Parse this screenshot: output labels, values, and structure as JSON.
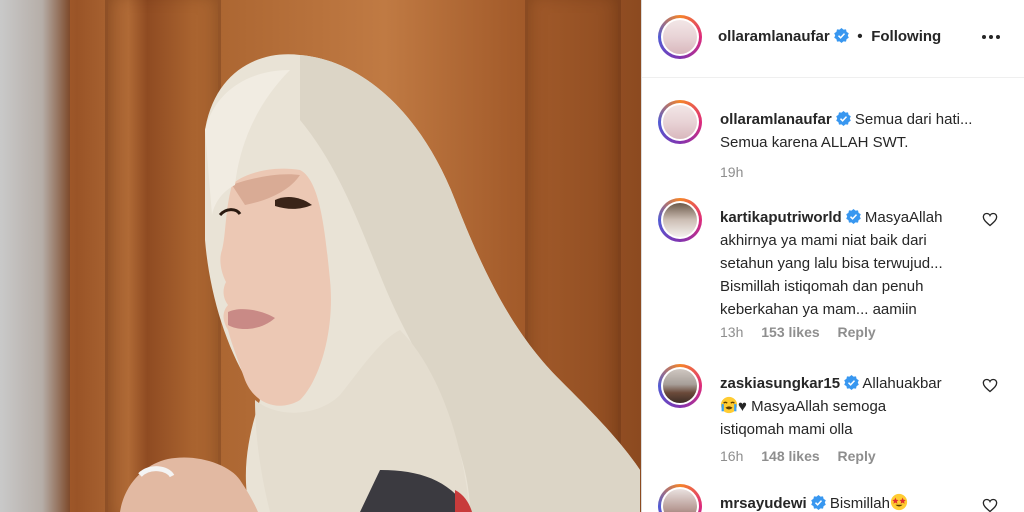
{
  "post": {
    "username": "ollaramlanaufar",
    "follow_status": "Following",
    "separator": "•"
  },
  "caption": {
    "username": "ollaramlanaufar",
    "line1": "Semua dari hati...",
    "line2": "Semua karena ALLAH SWT.",
    "time": "19h"
  },
  "comments": [
    {
      "username": "kartikaputriworld",
      "lines": [
        "MasyaAllah",
        "akhirnya ya mami niat baik dari",
        "setahun yang lalu bisa terwujud...",
        "Bismillah istiqomah dan penuh",
        "keberkahan ya mam... aamiin"
      ],
      "time": "13h",
      "likes": "153 likes",
      "reply": "Reply"
    },
    {
      "username": "zaskiasungkar15",
      "lines": [
        "Allahuakbar",
        "MasyaAllah semoga",
        "istiqomah mami olla"
      ],
      "time": "16h",
      "likes": "148 likes",
      "reply": "Reply"
    },
    {
      "username": "mrsayudewi",
      "lines": [
        "Bismillah"
      ],
      "time": "",
      "likes": "",
      "reply": ""
    }
  ],
  "icons": {
    "verified": "verified-badge-icon",
    "more": "more-options-icon",
    "heart": "heart-outline-icon",
    "crying_emoji": "loudly-crying-face-emoji",
    "heart_symbol": "♥",
    "starstruck_emoji": "star-struck-emoji"
  },
  "colors": {
    "verified_blue": "#3897f0",
    "text": "#262626",
    "muted": "#8e8e8e",
    "divider": "#dbdbdb"
  }
}
